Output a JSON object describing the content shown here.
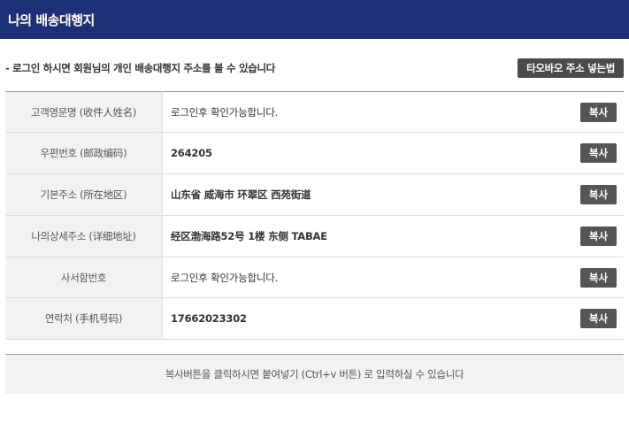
{
  "header": {
    "title": "나의 배송대행지"
  },
  "intro": {
    "text": "- 로그인 하시면 회원님의 개인 배송대행지 주소를 볼 수 있습니다",
    "guide_button": "타오바오 주소 넣는법"
  },
  "rows": [
    {
      "label": "고객영문명 (收件人姓名)",
      "value": "로그인후 확인가능합니다.",
      "copy": "복사"
    },
    {
      "label": "우편번호 (邮政编码)",
      "value": "264205",
      "copy": "복사"
    },
    {
      "label": "기본주소 (所在地区)",
      "value": "山东省 威海市 环翠区 西苑街道",
      "copy": "복사"
    },
    {
      "label": "나의상세주소 (详细地址)",
      "value": "经区渤海路52号 1楼 东侧 TABAE",
      "copy": "복사"
    },
    {
      "label": "사서함번호",
      "value": "로그인후 확인가능합니다.",
      "copy": "복사"
    },
    {
      "label": "연락처 (手机号码)",
      "value": "17662023302",
      "copy": "복사"
    }
  ],
  "footer": {
    "note": "복사버튼을 클릭하시면 붙여넣기 (Ctrl+v 버튼) 로 입력하실 수 있습니다"
  }
}
